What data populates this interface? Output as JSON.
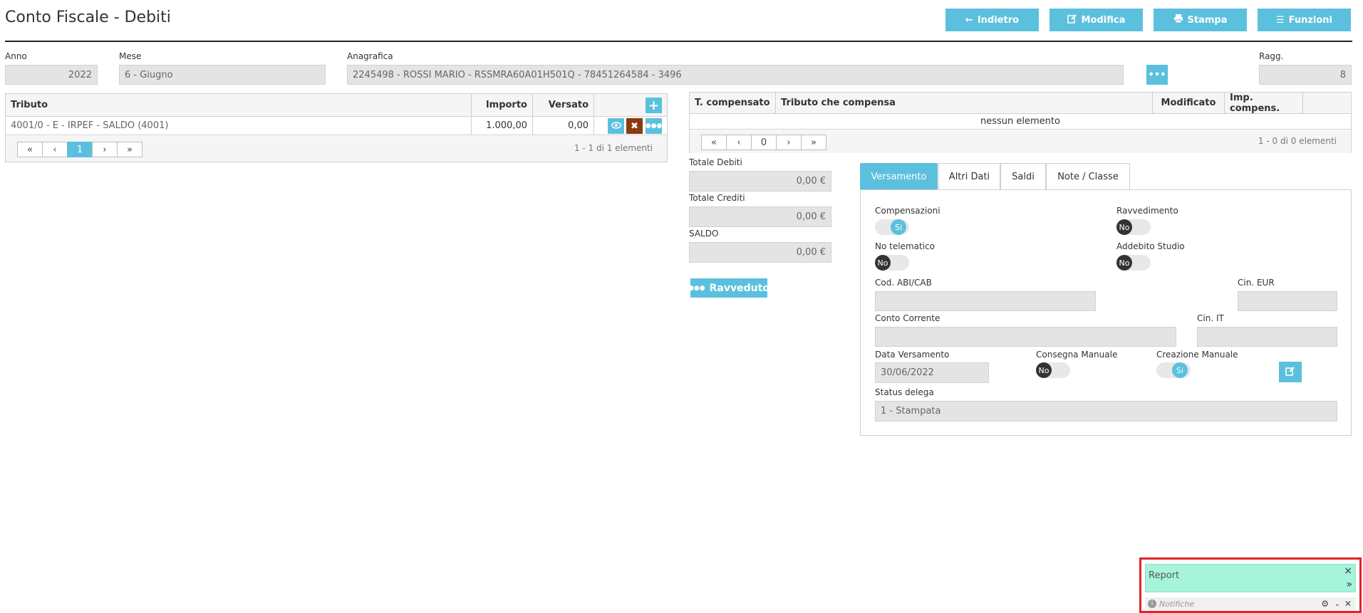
{
  "header": {
    "title": "Conto Fiscale - Debiti",
    "buttons": {
      "back": "Indietro",
      "edit": "Modifica",
      "print": "Stampa",
      "functions": "Funzioni"
    }
  },
  "form": {
    "anno": {
      "label": "Anno",
      "value": "2022"
    },
    "mese": {
      "label": "Mese",
      "value": "6 - Giugno"
    },
    "anagrafica": {
      "label": "Anagrafica",
      "value": "2245498 - ROSSI MARIO - RSSMRA60A01H501Q - 78451264584 - 3496"
    },
    "ragg": {
      "label": "Ragg.",
      "value": "8"
    }
  },
  "debiti_table": {
    "columns": {
      "tributo": "Tributo",
      "importo": "Importo",
      "versato": "Versato"
    },
    "rows": [
      {
        "tributo": "4001/0 - E - IRPEF - SALDO (4001)",
        "importo": "1.000,00",
        "versato": "0,00"
      }
    ],
    "pager": {
      "first": "«",
      "prev": "‹",
      "page": "1",
      "next": "›",
      "last": "»",
      "info": "1 - 1 di 1 elementi"
    }
  },
  "compensa_table": {
    "columns": {
      "t_compensato": "T. compensato",
      "tributo_compensa": "Tributo che compensa",
      "modificato": "Modificato",
      "imp_compens": "Imp. compens."
    },
    "empty": "nessun elemento",
    "pager": {
      "first": "«",
      "prev": "‹",
      "page": "0",
      "next": "›",
      "last": "»",
      "info": "1 - 0 di 0 elementi"
    }
  },
  "totals": {
    "debiti": {
      "label": "Totale Debiti",
      "value": "0,00 €"
    },
    "crediti": {
      "label": "Totale Crediti",
      "value": "0,00 €"
    },
    "saldo": {
      "label": "SALDO",
      "value": "0,00 €"
    },
    "ravveduto_button": "Ravveduto"
  },
  "tabs": [
    "Versamento",
    "Altri Dati",
    "Saldi",
    "Note / Classe"
  ],
  "versamento": {
    "compensazioni": {
      "label": "Compensazioni",
      "value": "Si"
    },
    "ravvedimento": {
      "label": "Ravvedimento",
      "value": "No"
    },
    "no_telematico": {
      "label": "No telematico",
      "value": "No"
    },
    "addebito_studio": {
      "label": "Addebito Studio",
      "value": "No"
    },
    "cod_abi_cab": {
      "label": "Cod. ABI/CAB",
      "value": ""
    },
    "cin_eur": {
      "label": "Cin. EUR",
      "value": ""
    },
    "conto_corrente": {
      "label": "Conto Corrente",
      "value": ""
    },
    "cin_it": {
      "label": "Cin. IT",
      "value": ""
    },
    "data_versamento": {
      "label": "Data Versamento",
      "value": "30/06/2022"
    },
    "consegna_manuale": {
      "label": "Consegna Manuale",
      "value": "No"
    },
    "creazione_manuale": {
      "label": "Creazione Manuale",
      "value": "Si"
    },
    "status_delega": {
      "label": "Status delega",
      "value": "1 - Stampata"
    }
  },
  "report": {
    "title": "Report",
    "close": "×",
    "expand": "»",
    "notifications_placeholder": "Notifiche"
  },
  "colors": {
    "accent": "#5bc0de",
    "delete": "#8b3a0e",
    "report_bg": "#a6f5db",
    "highlight": "#e2232a"
  }
}
